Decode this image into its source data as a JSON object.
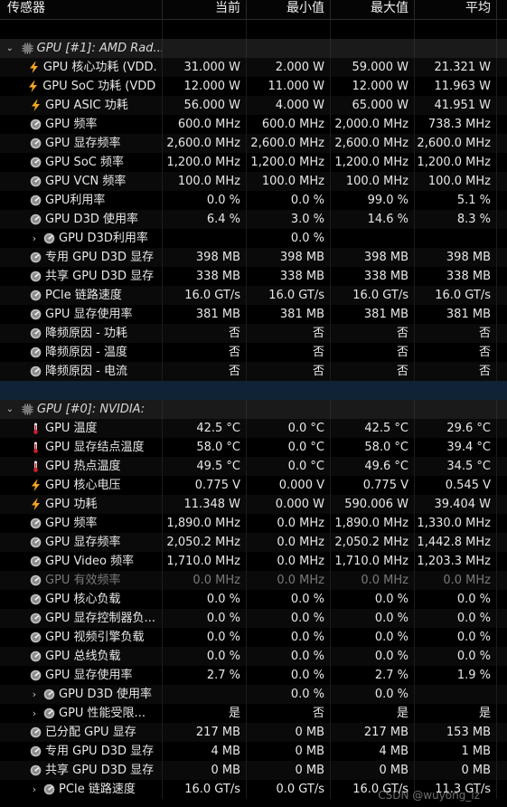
{
  "columns": {
    "sensor": "传感器",
    "current": "当前",
    "min": "最小值",
    "max": "最大值",
    "avg": "平均"
  },
  "groups": [
    {
      "title": "GPU [#1]: AMD Rad...",
      "rows": [
        {
          "icon": "bolt",
          "label": "GPU 核心功耗 (VDD...",
          "cur": "31.000 W",
          "min": "2.000 W",
          "max": "59.000 W",
          "avg": "21.321 W"
        },
        {
          "icon": "bolt",
          "label": "GPU SoC 功耗 (VDD...",
          "cur": "12.000 W",
          "min": "11.000 W",
          "max": "12.000 W",
          "avg": "11.963 W"
        },
        {
          "icon": "bolt",
          "label": "GPU ASIC 功耗",
          "cur": "56.000 W",
          "min": "4.000 W",
          "max": "65.000 W",
          "avg": "41.951 W"
        },
        {
          "icon": "clock",
          "label": "GPU 频率",
          "cur": "600.0 MHz",
          "min": "600.0 MHz",
          "max": "2,000.0 MHz",
          "avg": "738.3 MHz"
        },
        {
          "icon": "clock",
          "label": "GPU 显存频率",
          "cur": "2,600.0 MHz",
          "min": "2,600.0 MHz",
          "max": "2,600.0 MHz",
          "avg": "2,600.0 MHz"
        },
        {
          "icon": "clock",
          "label": "GPU SoC 频率",
          "cur": "1,200.0 MHz",
          "min": "1,200.0 MHz",
          "max": "1,200.0 MHz",
          "avg": "1,200.0 MHz"
        },
        {
          "icon": "clock",
          "label": "GPU VCN 频率",
          "cur": "100.0 MHz",
          "min": "100.0 MHz",
          "max": "100.0 MHz",
          "avg": "100.0 MHz"
        },
        {
          "icon": "clock",
          "label": "GPU利用率",
          "cur": "0.0 %",
          "min": "0.0 %",
          "max": "99.0 %",
          "avg": "5.1 %"
        },
        {
          "icon": "clock",
          "label": "GPU D3D 使用率",
          "cur": "6.4 %",
          "min": "3.0 %",
          "max": "14.6 %",
          "avg": "8.3 %"
        },
        {
          "icon": "clock",
          "label": "GPU D3D利用率",
          "expand": true,
          "cur": "",
          "min": "0.0 %",
          "max": "",
          "avg": ""
        },
        {
          "icon": "clock",
          "label": "专用 GPU D3D 显存",
          "cur": "398 MB",
          "min": "398 MB",
          "max": "398 MB",
          "avg": "398 MB"
        },
        {
          "icon": "clock",
          "label": "共享 GPU D3D 显存",
          "cur": "338 MB",
          "min": "338 MB",
          "max": "338 MB",
          "avg": "338 MB"
        },
        {
          "icon": "clock",
          "label": "PCIe 链路速度",
          "cur": "16.0 GT/s",
          "min": "16.0 GT/s",
          "max": "16.0 GT/s",
          "avg": "16.0 GT/s"
        },
        {
          "icon": "clock",
          "label": "GPU 显存使用率",
          "cur": "381 MB",
          "min": "381 MB",
          "max": "381 MB",
          "avg": "381 MB"
        },
        {
          "icon": "clock",
          "label": "降频原因 - 功耗",
          "cur": "否",
          "min": "否",
          "max": "否",
          "avg": "否"
        },
        {
          "icon": "clock",
          "label": "降频原因 - 温度",
          "cur": "否",
          "min": "否",
          "max": "否",
          "avg": "否"
        },
        {
          "icon": "clock",
          "label": "降频原因 - 电流",
          "cur": "否",
          "min": "否",
          "max": "否",
          "avg": "否"
        }
      ]
    },
    {
      "title": "GPU [#0]: NVIDIA:",
      "rows": [
        {
          "icon": "thermo",
          "label": "GPU 温度",
          "cur": "42.5 °C",
          "min": "0.0 °C",
          "max": "42.5 °C",
          "avg": "29.6 °C"
        },
        {
          "icon": "thermo",
          "label": "GPU 显存结点温度",
          "cur": "58.0 °C",
          "min": "0.0 °C",
          "max": "58.0 °C",
          "avg": "39.4 °C"
        },
        {
          "icon": "thermo",
          "label": "GPU 热点温度",
          "cur": "49.5 °C",
          "min": "0.0 °C",
          "max": "49.6 °C",
          "avg": "34.5 °C"
        },
        {
          "icon": "bolt",
          "label": "GPU 核心电压",
          "cur": "0.775 V",
          "min": "0.000 V",
          "max": "0.775 V",
          "avg": "0.545 V"
        },
        {
          "icon": "bolt",
          "label": "GPU 功耗",
          "cur": "11.348 W",
          "min": "0.000 W",
          "max": "590.006 W",
          "avg": "39.404 W"
        },
        {
          "icon": "clock",
          "label": "GPU 频率",
          "cur": "1,890.0 MHz",
          "min": "0.0 MHz",
          "max": "1,890.0 MHz",
          "avg": "1,330.0 MHz"
        },
        {
          "icon": "clock",
          "label": "GPU 显存频率",
          "cur": "2,050.2 MHz",
          "min": "0.0 MHz",
          "max": "2,050.2 MHz",
          "avg": "1,442.8 MHz"
        },
        {
          "icon": "clock",
          "label": "GPU Video 频率",
          "cur": "1,710.0 MHz",
          "min": "0.0 MHz",
          "max": "1,710.0 MHz",
          "avg": "1,203.3 MHz"
        },
        {
          "icon": "clock",
          "label": "GPU 有效频率",
          "dim": true,
          "cur": "0.0 MHz",
          "min": "0.0 MHz",
          "max": "0.0 MHz",
          "avg": "0.0 MHz"
        },
        {
          "icon": "clock",
          "label": "GPU 核心负载",
          "cur": "0.0 %",
          "min": "0.0 %",
          "max": "0.0 %",
          "avg": "0.0 %"
        },
        {
          "icon": "clock",
          "label": "GPU 显存控制器负...",
          "cur": "0.0 %",
          "min": "0.0 %",
          "max": "0.0 %",
          "avg": "0.0 %"
        },
        {
          "icon": "clock",
          "label": "GPU 视频引擎负载",
          "cur": "0.0 %",
          "min": "0.0 %",
          "max": "0.0 %",
          "avg": "0.0 %"
        },
        {
          "icon": "clock",
          "label": "GPU 总线负载",
          "cur": "0.0 %",
          "min": "0.0 %",
          "max": "0.0 %",
          "avg": "0.0 %"
        },
        {
          "icon": "clock",
          "label": "GPU 显存使用率",
          "cur": "2.7 %",
          "min": "0.0 %",
          "max": "2.7 %",
          "avg": "1.9 %"
        },
        {
          "icon": "clock",
          "label": "GPU D3D 使用率",
          "expand": true,
          "cur": "",
          "min": "0.0 %",
          "max": "0.0 %",
          "avg": ""
        },
        {
          "icon": "clock",
          "label": "GPU 性能受限...",
          "expand": true,
          "cur": "是",
          "min": "否",
          "max": "是",
          "avg": "是"
        },
        {
          "icon": "clock",
          "label": "已分配 GPU 显存",
          "cur": "217 MB",
          "min": "0 MB",
          "max": "217 MB",
          "avg": "153 MB"
        },
        {
          "icon": "clock",
          "label": "专用 GPU D3D 显存",
          "cur": "4 MB",
          "min": "0 MB",
          "max": "4 MB",
          "avg": "1 MB"
        },
        {
          "icon": "clock",
          "label": "共享 GPU D3D 显存",
          "cur": "0 MB",
          "min": "0 MB",
          "max": "0 MB",
          "avg": "0 MB"
        },
        {
          "icon": "clock",
          "label": "PCIe 链路速度",
          "expand": true,
          "cur": "16.0 GT/s",
          "min": "0.0 GT/s",
          "max": "16.0 GT/s",
          "avg": "11.3 GT/s"
        }
      ]
    }
  ],
  "watermark": "CSDN @wuyong_lz",
  "colors": {
    "bolt": "#f5a623",
    "thermo": "#d0202a",
    "clock": "#bdbdbd",
    "separator": "#0f2236"
  }
}
